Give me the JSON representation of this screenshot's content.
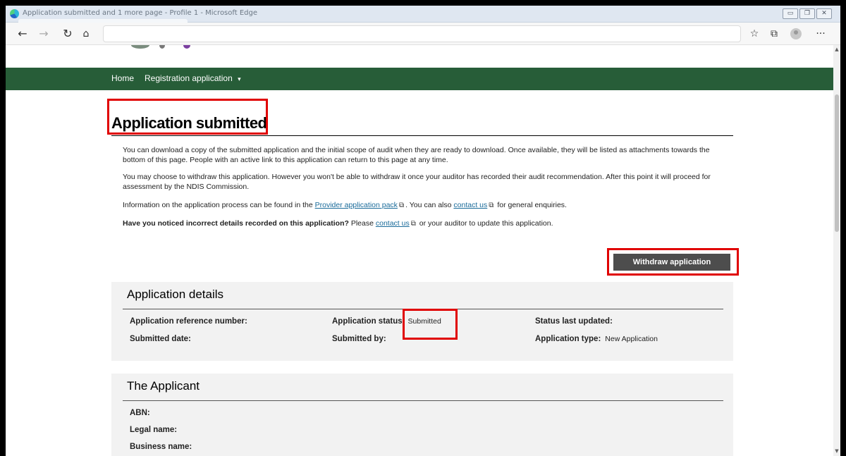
{
  "browser": {
    "window_title": "Application submitted and 1 more page - Profile 1 - Microsoft Edge",
    "url": "",
    "more_label": "···"
  },
  "nav": {
    "home": "Home",
    "registration": "Registration application",
    "caret": "▾"
  },
  "page": {
    "title": "Application submitted",
    "p1": "You can download a copy of the submitted application and the initial scope of audit when they are ready to download. Once available, they will be listed as attachments towards the bottom of this page. People with an active link to this application can return to this page at any time.",
    "p2": "You may choose to withdraw this application. However you won't be able to withdraw it once your auditor has recorded their audit recommendation. After this point it will proceed for assessment by the NDIS Commission.",
    "p3_a": "Information on the application process can be found in the ",
    "p3_link1": "Provider application pack",
    "p3_b": ". You can also ",
    "p3_link2": "contact us",
    "p3_c": " for general enquiries.",
    "p4_bold": "Have you noticed incorrect details recorded on this application?",
    "p4_a": " Please ",
    "p4_link": "contact us",
    "p4_b": " or your auditor to update this application.",
    "withdraw_label": "Withdraw application"
  },
  "details": {
    "heading": "Application details",
    "ref_label": "Application reference number:",
    "ref_value": "",
    "status_label": "Application status:",
    "status_value": "Submitted",
    "updated_label": "Status last updated:",
    "updated_value": "",
    "submitted_date_label": "Submitted date:",
    "submitted_date_value": "",
    "submitted_by_label": "Submitted by:",
    "submitted_by_value": "",
    "type_label": "Application type:",
    "type_value": "New Application"
  },
  "applicant": {
    "heading": "The Applicant",
    "abn_label": "ABN:",
    "legal_label": "Legal name:",
    "business_label": "Business name:"
  },
  "colors": {
    "nav_green": "#275d38",
    "button_grey": "#4d4d4d",
    "highlight_red": "#e00000",
    "link_blue": "#1a6b9a"
  }
}
